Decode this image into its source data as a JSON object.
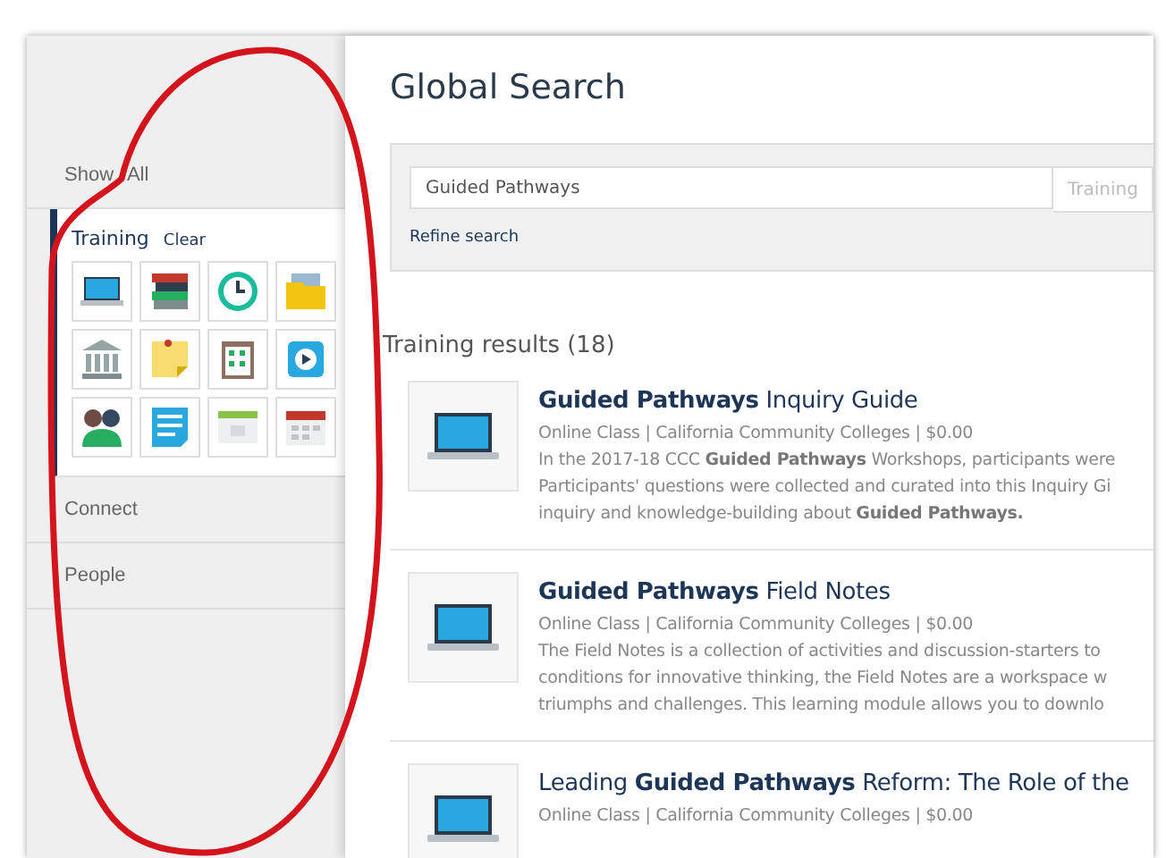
{
  "sidebar": {
    "items": [
      {
        "label": "Show All",
        "selected": false
      },
      {
        "label": "Training",
        "selected": true,
        "clear_label": "Clear",
        "tiles": [
          {
            "kind": "laptop"
          },
          {
            "kind": "books"
          },
          {
            "kind": "clock"
          },
          {
            "kind": "folder"
          },
          {
            "kind": "building"
          },
          {
            "kind": "note"
          },
          {
            "kind": "clipboard"
          },
          {
            "kind": "video"
          },
          {
            "kind": "people"
          },
          {
            "kind": "document"
          },
          {
            "kind": "browser"
          },
          {
            "kind": "calendar"
          }
        ]
      },
      {
        "label": "Connect",
        "selected": false
      },
      {
        "label": "People",
        "selected": false
      }
    ]
  },
  "title": "Global Search",
  "search": {
    "value": "Guided Pathways",
    "category": "Training",
    "refine_link": "Refine search"
  },
  "results_heading": "Training results (18)",
  "results": [
    {
      "title": "**Guided Pathways** Inquiry Guide",
      "meta": "Online Class  |  California Community Colleges  |  $0.00",
      "description": [
        "In the 2017-18 CCC **Guided Pathways** Workshops, participants were",
        "Participants' questions were collected and curated into this Inquiry Gi",
        "inquiry and knowledge-building about **Guided Pathways.**"
      ]
    },
    {
      "title": "**Guided Pathways** Field Notes",
      "meta": "Online Class  |  California Community Colleges  |  $0.00",
      "description": [
        "The Field Notes is a collection of activities and discussion-starters to",
        "conditions for innovative thinking, the Field Notes are a workspace w",
        "triumphs and challenges. This learning module allows you to downlo"
      ]
    },
    {
      "title": "Leading **Guided Pathways** Reform: The Role of the",
      "meta": "Online Class  |  California Community Colleges  |  $0.00"
    }
  ]
}
